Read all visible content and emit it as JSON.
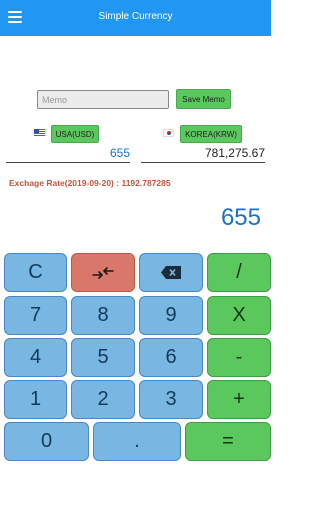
{
  "header": {
    "title": "Simple Currency"
  },
  "memo": {
    "placeholder": "Memo",
    "save_label": "Save Memo"
  },
  "from": {
    "currency_label": "USA(USD)",
    "amount": "655",
    "flag": "us-flag"
  },
  "to": {
    "currency_label": "KOREA(KRW)",
    "amount": "781,275.67",
    "flag": "kr-flag"
  },
  "rate_text": "Exchage Rate(2019-09-20) : 1192.787285",
  "display": "655",
  "keys": {
    "clear": "C",
    "swap_icon": "swap-arrows-icon",
    "backspace_icon": "backspace-icon",
    "divide": "/",
    "seven": "7",
    "eight": "8",
    "nine": "9",
    "multiply": "X",
    "four": "4",
    "five": "5",
    "six": "6",
    "minus": "-",
    "one": "1",
    "two": "2",
    "three": "3",
    "plus": "+",
    "zero": "0",
    "dot": ".",
    "equals": "="
  },
  "colors": {
    "accent": "#2196f3",
    "number_key": "#79b7e3",
    "operator_key": "#5bc85d",
    "swap_key": "#d9776a",
    "rate_text": "#c0563f"
  }
}
